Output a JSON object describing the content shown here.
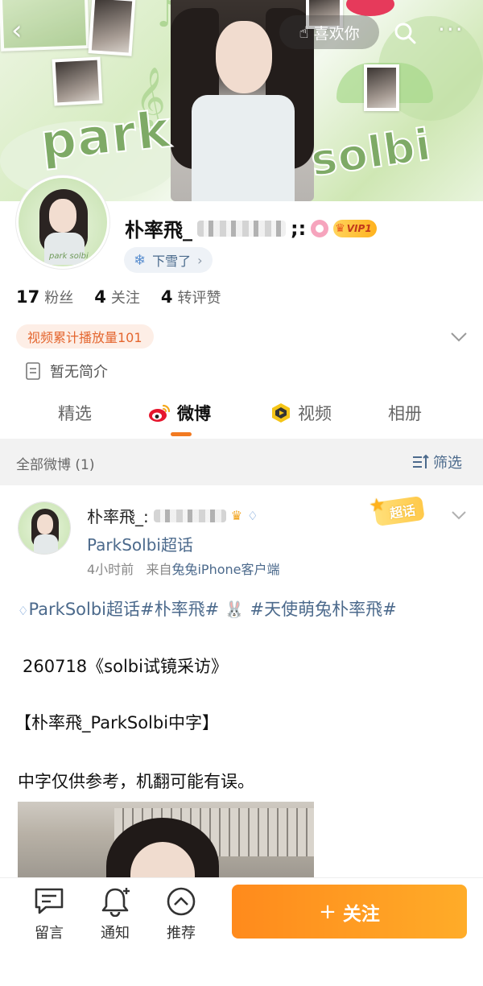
{
  "banner": {
    "word_left": "park",
    "word_right": "solbi",
    "like_label": "喜欢你"
  },
  "profile": {
    "avatar_caption": "park solbi",
    "username": "朴率飛_",
    "username_suffix": ";:",
    "vip_label": "VIP1",
    "mood_label": "下雪了",
    "stats": [
      {
        "num": "17",
        "label": "粉丝"
      },
      {
        "num": "4",
        "label": "关注"
      },
      {
        "num": "4",
        "label": "转评赞"
      }
    ],
    "play_tag": "视频累计播放量101",
    "bio": "暂无简介"
  },
  "tabs": [
    {
      "label": "精选",
      "active": false
    },
    {
      "label": "微博",
      "active": true
    },
    {
      "label": "视频",
      "active": false
    },
    {
      "label": "相册",
      "active": false
    }
  ],
  "filter": {
    "count_label": "全部微博 (1)",
    "filter_label": "筛选"
  },
  "post": {
    "author": "朴率飛_:",
    "topic": "ParkSolbi超话",
    "time": "4小时前",
    "from_prefix": "来自",
    "source": "兔兔iPhone客户端",
    "super_badge": "超话",
    "tags_a": "ParkSolbi超话#朴率飛#",
    "tags_b": "#天使萌兔朴率飛#",
    "line2": "260718《solbi试镜采访》",
    "line3": "【朴率飛_ParkSolbi中字】",
    "line4": "中字仅供参考，机翻可能有误。"
  },
  "bottom": {
    "comment_label": "留言",
    "notify_label": "通知",
    "recommend_label": "推荐",
    "follow_label": "关注",
    "follow_color": "#ff9a22"
  },
  "icons": [
    "back-icon",
    "like-icon",
    "search-icon",
    "more-icon",
    "ears-icon",
    "crown-icon",
    "snow-icon",
    "chevron-down-icon",
    "doc-icon",
    "weibo-icon",
    "video-icon",
    "filter-icon",
    "diamond-icon",
    "rabbit-icon",
    "message-icon",
    "bell-icon",
    "recommend-icon",
    "plus-icon"
  ]
}
